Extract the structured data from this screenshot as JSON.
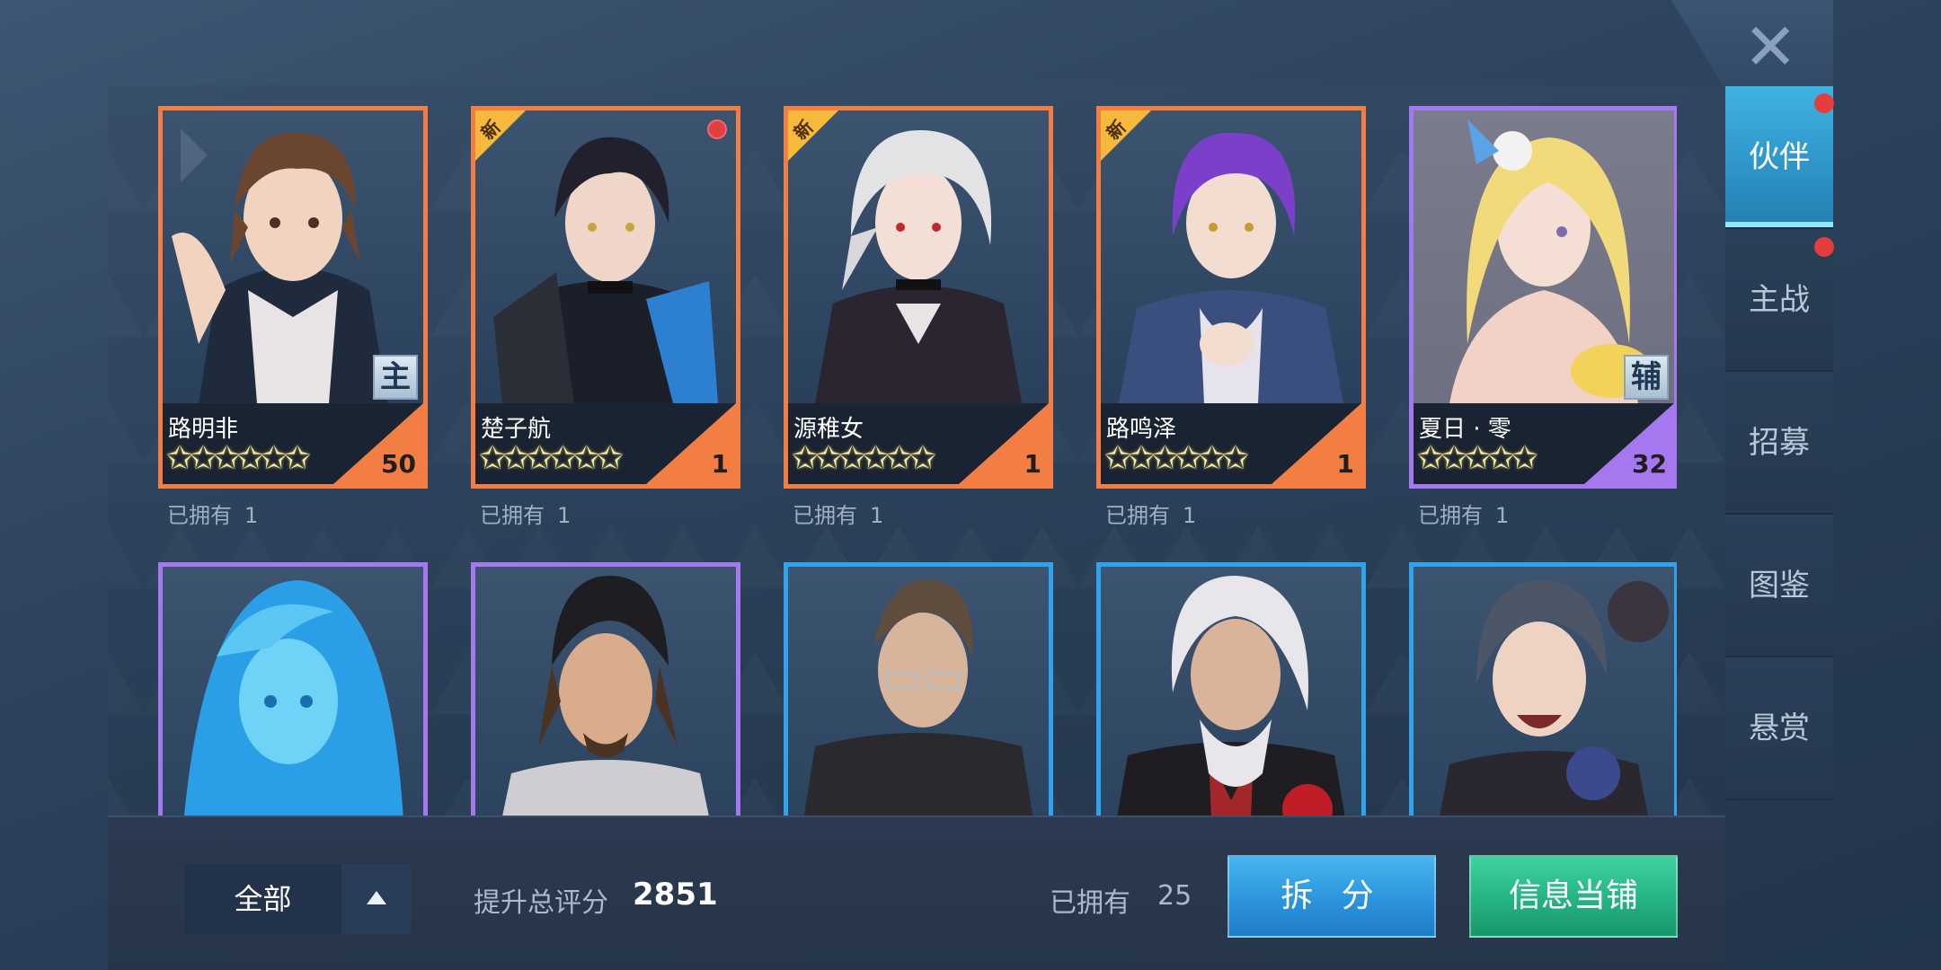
{
  "close_icon": "close-x-icon",
  "nav": {
    "items": [
      {
        "label": "伙伴",
        "active": true,
        "dot": true
      },
      {
        "label": "主战",
        "active": false,
        "dot": true
      },
      {
        "label": "招募",
        "active": false,
        "dot": false
      },
      {
        "label": "图鉴",
        "active": false,
        "dot": false
      },
      {
        "label": "悬赏",
        "active": false,
        "dot": false
      }
    ]
  },
  "cards": [
    {
      "name": "路明非",
      "stars": "✩✩✩✩✩✩",
      "level": "50",
      "frame": "orange",
      "owned_label": "已拥有",
      "owned": "1",
      "new": false,
      "new_label": "",
      "dot": false,
      "role": "主"
    },
    {
      "name": "楚子航",
      "stars": "✩✩✩✩✩✩",
      "level": "1",
      "frame": "orange",
      "owned_label": "已拥有",
      "owned": "1",
      "new": true,
      "new_label": "新",
      "dot": true,
      "role": ""
    },
    {
      "name": "源稚女",
      "stars": "✩✩✩✩✩✩",
      "level": "1",
      "frame": "orange",
      "owned_label": "已拥有",
      "owned": "1",
      "new": true,
      "new_label": "新",
      "dot": false,
      "role": ""
    },
    {
      "name": "路鸣泽",
      "stars": "✩✩✩✩✩✩",
      "level": "1",
      "frame": "orange",
      "owned_label": "已拥有",
      "owned": "1",
      "new": true,
      "new_label": "新",
      "dot": false,
      "role": ""
    },
    {
      "name": "夏日 · 零",
      "stars": "✩✩✩✩✩",
      "level": "32",
      "frame": "purple",
      "owned_label": "已拥有",
      "owned": "1",
      "new": false,
      "new_label": "",
      "dot": false,
      "role": "辅"
    },
    {
      "frame": "purple",
      "portrait": "blue-haired-girl"
    },
    {
      "frame": "purple",
      "portrait": "bandana-man"
    },
    {
      "frame": "blue",
      "portrait": "glasses-old-man"
    },
    {
      "frame": "blue",
      "portrait": "white-hair-elder"
    },
    {
      "frame": "blue",
      "portrait": "laughing-man"
    }
  ],
  "bottom": {
    "filter_label": "全部",
    "score_label": "提升总评分",
    "score_value": "2851",
    "owned_label": "已拥有",
    "owned_value": "25",
    "split_button": "拆 分",
    "pawn_button": "信息当铺"
  },
  "colors": {
    "orange_frame": "#f37e44",
    "purple_frame": "#a578f0",
    "blue_frame": "#2fa3ee",
    "active_nav": "#3fb3e2",
    "split_btn": "#2a91db",
    "pawn_btn": "#23b07f",
    "notify_dot": "#e33d3d"
  }
}
